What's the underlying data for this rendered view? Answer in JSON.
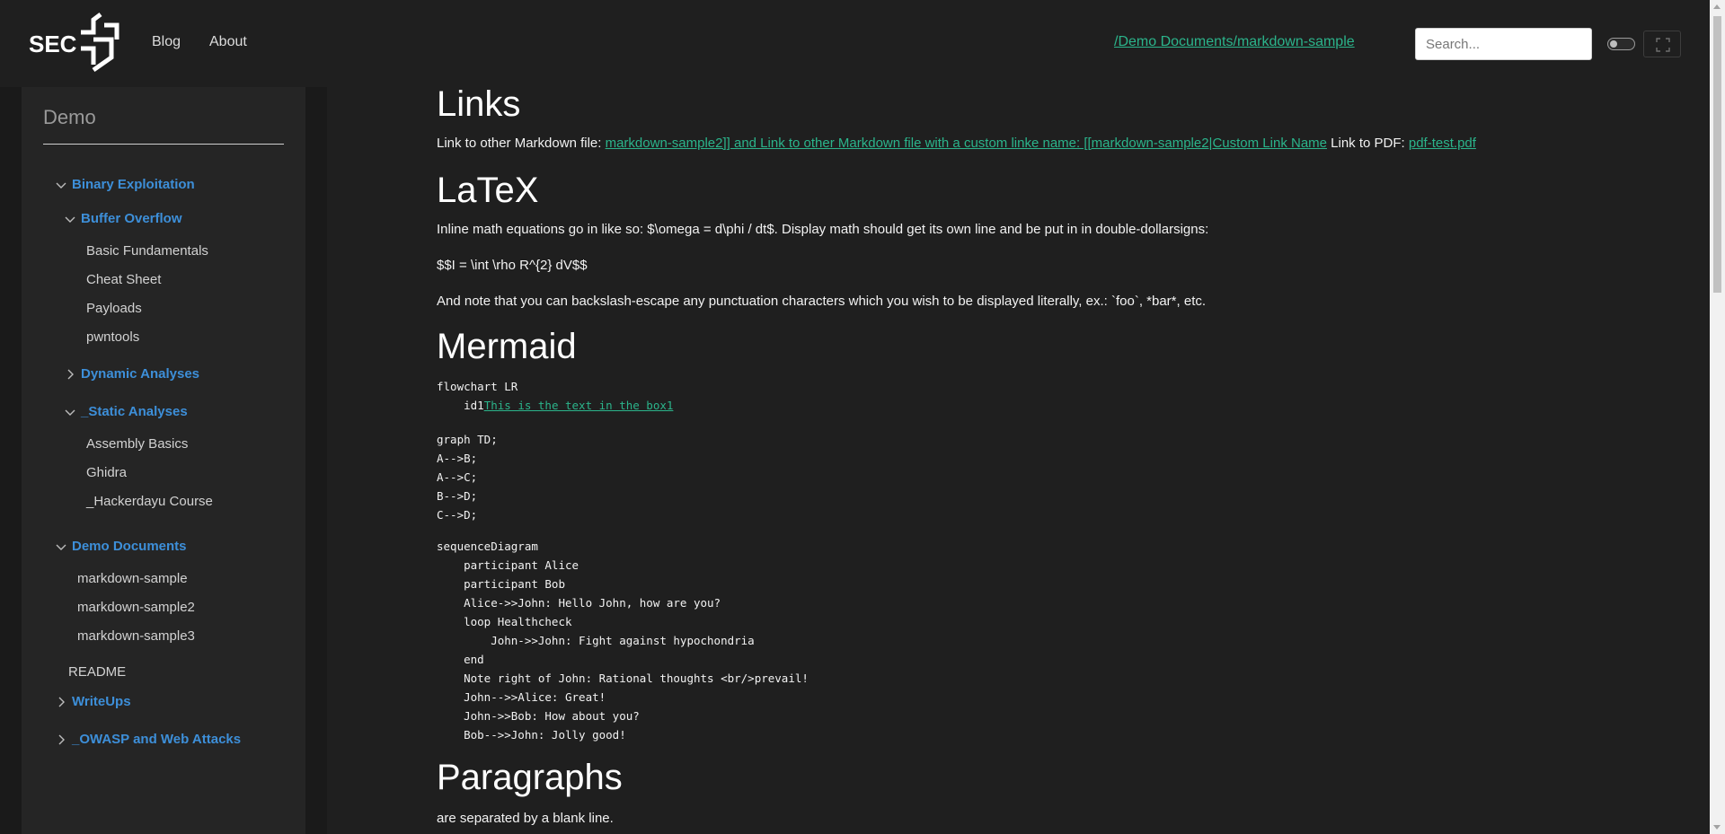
{
  "header": {
    "logo_alt": "SEC logo",
    "nav": [
      "Blog",
      "About"
    ],
    "breadcrumb": "/Demo Documents/markdown-sample",
    "search_placeholder": "Search..."
  },
  "sidebar": {
    "title": "Demo",
    "items": [
      {
        "label": "Binary Exploitation",
        "kind": "folder",
        "state": "expanded"
      },
      {
        "label": "Buffer Overflow",
        "kind": "folder",
        "state": "expanded"
      },
      {
        "label": "Basic Fundamentals",
        "kind": "leaf"
      },
      {
        "label": "Cheat Sheet",
        "kind": "leaf"
      },
      {
        "label": "Payloads",
        "kind": "leaf"
      },
      {
        "label": "pwntools",
        "kind": "leaf"
      },
      {
        "label": "Dynamic Analyses",
        "kind": "folder",
        "state": "collapsed"
      },
      {
        "label": "_Static Analyses",
        "kind": "folder",
        "state": "expanded"
      },
      {
        "label": "Assembly Basics",
        "kind": "leaf"
      },
      {
        "label": "Ghidra",
        "kind": "leaf"
      },
      {
        "label": "_Hackerdayu Course",
        "kind": "leaf"
      },
      {
        "label": "Demo Documents",
        "kind": "folder",
        "state": "expanded"
      },
      {
        "label": "markdown-sample",
        "kind": "leaf"
      },
      {
        "label": "markdown-sample2",
        "kind": "leaf"
      },
      {
        "label": "markdown-sample3",
        "kind": "leaf"
      },
      {
        "label": "README",
        "kind": "leaf"
      },
      {
        "label": "WriteUps",
        "kind": "folder",
        "state": "collapsed"
      },
      {
        "label": "_OWASP and Web Attacks",
        "kind": "folder",
        "state": "collapsed"
      }
    ]
  },
  "content": {
    "links": {
      "heading": "Links",
      "text_prefix": "Link to other Markdown file: ",
      "link_md": "markdown-sample2]] and Link to other Markdown file with a custom linke name: [[markdown-sample2|Custom Link Name",
      "text_pdf": " Link to PDF: ",
      "link_pdf": "pdf-test.pdf"
    },
    "latex": {
      "heading": "LaTeX",
      "line1": "Inline math equations go in like so: $\\omega = d\\phi / dt$. Display math should get its own line and be put in in double-dollarsigns:",
      "line2": "$$I = \\int \\rho R^{2} dV$$",
      "line3": "And note that you can backslash-escape any punctuation characters which you wish to be displayed literally, ex.: `foo`, *bar*, etc."
    },
    "mermaid": {
      "heading": "Mermaid",
      "block1_line1": "flowchart LR",
      "block1_prefix": "    id1",
      "block1_link": "This is the text in the box1",
      "block2": "graph TD;\nA-->B;\nA-->C;\nB-->D;\nC-->D;",
      "block3": "sequenceDiagram\n    participant Alice\n    participant Bob\n    Alice->>John: Hello John, how are you?\n    loop Healthcheck\n        John->>John: Fight against hypochondria\n    end\n    Note right of John: Rational thoughts <br/>prevail!\n    John-->>Alice: Great!\n    John->>Bob: How about you?\n    Bob-->>John: Jolly good!"
    },
    "paragraphs": {
      "heading": "Paragraphs",
      "line1": "are separated by a blank line."
    }
  },
  "colors": {
    "background": "#1f1f1f",
    "sidebar": "#252525",
    "link": "#2bb48b",
    "folder": "#3d8fd9"
  }
}
